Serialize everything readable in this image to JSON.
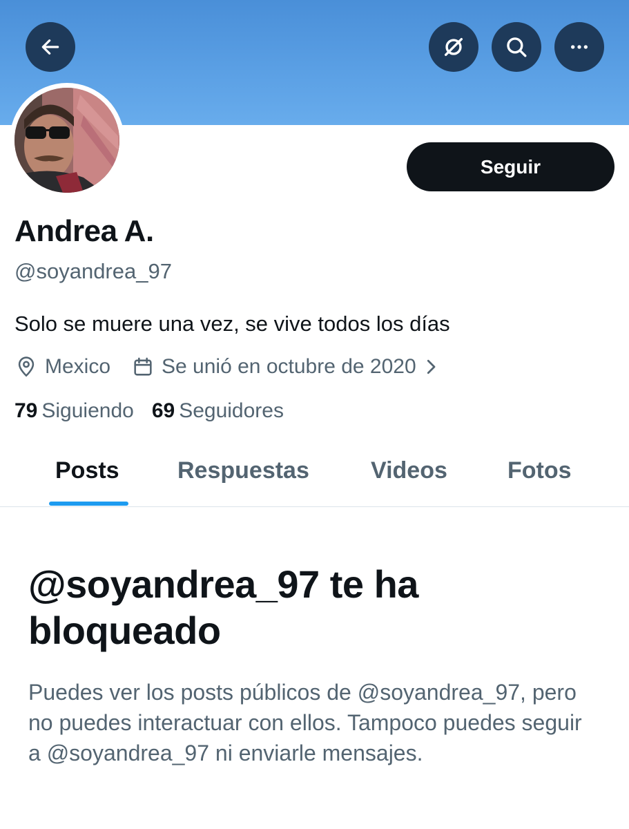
{
  "header": {
    "back_icon": "arrow-left-icon",
    "grok_icon": "grok-icon",
    "search_icon": "search-icon",
    "more_icon": "more-horizontal-icon",
    "banner_color": "#5a9fe4"
  },
  "profile": {
    "display_name": "Andrea A.",
    "handle": "@soyandrea_97",
    "bio": "Solo se muere una vez, se vive todos los días",
    "location": "Mexico",
    "joined": "Se unió en octubre de 2020",
    "following_count": "79",
    "following_label": "Siguiendo",
    "followers_count": "69",
    "followers_label": "Seguidores",
    "follow_button": "Seguir"
  },
  "tabs": [
    {
      "label": "Posts",
      "active": true
    },
    {
      "label": "Respuestas",
      "active": false
    },
    {
      "label": "Videos",
      "active": false
    },
    {
      "label": "Fotos",
      "active": false
    }
  ],
  "blocked_notice": {
    "title": "@soyandrea_97 te ha bloqueado",
    "description": "Puedes ver los posts públicos de @soyandrea_97, pero no puedes interactuar con ellos. Tampoco puedes seguir a @soyandrea_97 ni enviarle mensajes."
  },
  "colors": {
    "accent": "#1d9bf0",
    "text_primary": "#0f1419",
    "text_secondary": "#536471"
  }
}
